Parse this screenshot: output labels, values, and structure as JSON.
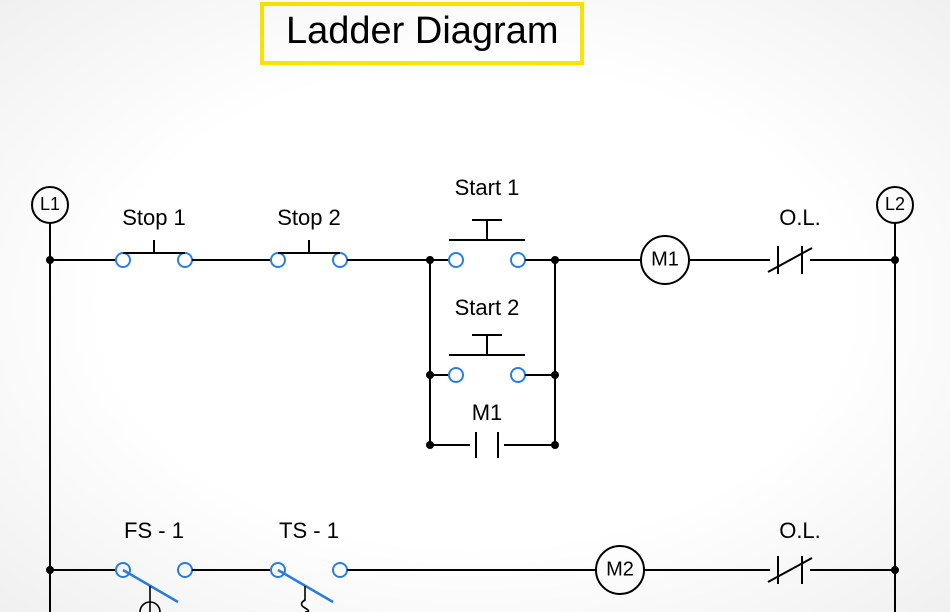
{
  "title": "Ladder Diagram",
  "colors": {
    "highlight": "#ffe500",
    "contact": "#2a7fdc"
  },
  "rails": {
    "left": "L1",
    "right": "L2"
  },
  "rung1": {
    "stop1": "Stop 1",
    "stop2": "Stop 2",
    "start1": "Start 1",
    "start2": "Start 2",
    "seal_in": "M1",
    "coil": "M1",
    "overload": "O.L."
  },
  "rung2": {
    "flow_switch": "FS - 1",
    "temp_switch": "TS - 1",
    "coil": "M2",
    "overload": "O.L."
  }
}
